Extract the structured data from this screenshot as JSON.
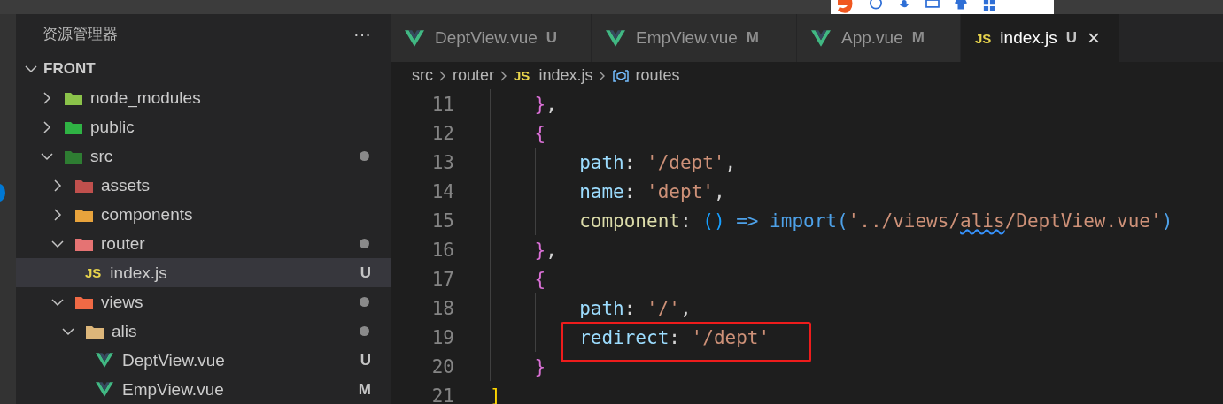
{
  "sidebar": {
    "title": "资源管理器",
    "more": "···",
    "root": {
      "label": "FRONT",
      "expanded": true,
      "children": [
        {
          "label": "node_modules",
          "kind": "folder",
          "color": "#8bc34a",
          "expanded": false,
          "selected": false,
          "dot": false
        },
        {
          "label": "public",
          "kind": "folder",
          "color": "#2fb344",
          "expanded": false,
          "selected": false,
          "dot": false
        },
        {
          "label": "src",
          "kind": "folder",
          "color": "#2e7d32",
          "expanded": true,
          "selected": false,
          "dot": true,
          "children": [
            {
              "label": "assets",
              "kind": "folder",
              "color": "#c0504d",
              "expanded": false,
              "selected": false,
              "dot": false
            },
            {
              "label": "components",
              "kind": "folder",
              "color": "#e8a33c",
              "expanded": false,
              "selected": false,
              "dot": false
            },
            {
              "label": "router",
              "kind": "folder",
              "color": "#e57373",
              "expanded": true,
              "selected": false,
              "dot": true,
              "children": [
                {
                  "label": "index.js",
                  "kind": "js",
                  "badge": "JS",
                  "selected": true,
                  "dot": false,
                  "status": "U"
                }
              ]
            },
            {
              "label": "views",
              "kind": "folder",
              "color": "#f06a45",
              "expanded": true,
              "selected": false,
              "dot": true,
              "children": [
                {
                  "label": "alis",
                  "kind": "folder",
                  "color": "#dcb67a",
                  "expanded": true,
                  "selected": false,
                  "dot": true,
                  "children": [
                    {
                      "label": "DeptView.vue",
                      "kind": "vue",
                      "selected": false,
                      "dot": false,
                      "status": "U"
                    },
                    {
                      "label": "EmpView.vue",
                      "kind": "vue",
                      "selected": false,
                      "dot": false,
                      "status": "M"
                    }
                  ]
                }
              ]
            }
          ]
        }
      ]
    }
  },
  "tabs": [
    {
      "label": "DeptView.vue",
      "kind": "vue",
      "status": "U",
      "selected": false
    },
    {
      "label": "EmpView.vue",
      "kind": "vue",
      "status": "M",
      "selected": false
    },
    {
      "label": "App.vue",
      "kind": "vue",
      "status": "M",
      "selected": false
    },
    {
      "label": "index.js",
      "kind": "js",
      "badge": "JS",
      "status": "U",
      "close": "×",
      "selected": true
    }
  ],
  "breadcrumb": [
    {
      "label": "src",
      "kind": "folder"
    },
    {
      "label": "router",
      "kind": "folder"
    },
    {
      "label": "index.js",
      "kind": "js",
      "badge": "JS"
    },
    {
      "label": "routes",
      "kind": "symbol"
    }
  ],
  "editor": {
    "lines": [
      {
        "number": "11",
        "highlight": false,
        "tokens": [
          {
            "t": "    }",
            "kind": "bracket2"
          },
          {
            "t": ",",
            "kind": "plain"
          }
        ]
      },
      {
        "number": "12",
        "highlight": false,
        "tokens": [
          {
            "t": "    {",
            "kind": "bracket2"
          }
        ]
      },
      {
        "number": "13",
        "highlight": false,
        "tokens": [
          {
            "t": "        path",
            "kind": "key"
          },
          {
            "t": ": ",
            "kind": "plain"
          },
          {
            "t": "'/dept'",
            "kind": "string"
          },
          {
            "t": ",",
            "kind": "plain"
          }
        ]
      },
      {
        "number": "14",
        "highlight": false,
        "tokens": [
          {
            "t": "        name",
            "kind": "key"
          },
          {
            "t": ": ",
            "kind": "plain"
          },
          {
            "t": "'dept'",
            "kind": "string"
          },
          {
            "t": ",",
            "kind": "plain"
          }
        ]
      },
      {
        "number": "15",
        "highlight": false,
        "tokens": [
          {
            "t": "        component",
            "kind": "func"
          },
          {
            "t": ": ",
            "kind": "plain"
          },
          {
            "t": "()",
            "kind": "paren"
          },
          {
            "t": " => import(",
            "kind": "keyword"
          },
          {
            "t": "'../views/",
            "kind": "string"
          },
          {
            "t": "alis",
            "kind": "misspelled"
          },
          {
            "t": "/DeptView.vue'",
            "kind": "string"
          },
          {
            "t": ")",
            "kind": "keyword"
          }
        ]
      },
      {
        "number": "16",
        "highlight": false,
        "tokens": [
          {
            "t": "    }",
            "kind": "bracket2"
          },
          {
            "t": ",",
            "kind": "plain"
          }
        ]
      },
      {
        "number": "17",
        "highlight": false,
        "tokens": [
          {
            "t": "    {",
            "kind": "bracket2"
          }
        ]
      },
      {
        "number": "18",
        "highlight": false,
        "tokens": [
          {
            "t": "        path",
            "kind": "key"
          },
          {
            "t": ": ",
            "kind": "plain"
          },
          {
            "t": "'/'",
            "kind": "string"
          },
          {
            "t": ",",
            "kind": "plain"
          }
        ]
      },
      {
        "number": "19",
        "highlight": true,
        "tokens": [
          {
            "t": "        redirect",
            "kind": "key"
          },
          {
            "t": ": ",
            "kind": "plain"
          },
          {
            "t": "'/dept'",
            "kind": "string"
          }
        ]
      },
      {
        "number": "20",
        "highlight": false,
        "tokens": [
          {
            "t": "    }",
            "kind": "bracket2"
          }
        ]
      },
      {
        "number": "21",
        "highlight": false,
        "tokens": [
          {
            "t": "]",
            "kind": "bracket1"
          }
        ]
      }
    ]
  }
}
